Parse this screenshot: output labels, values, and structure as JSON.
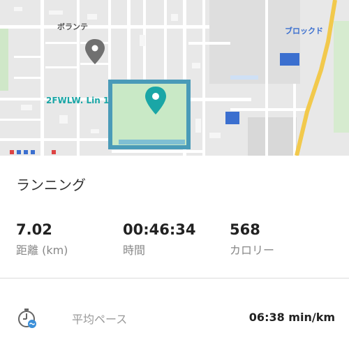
{
  "map": {
    "place_label_top": "ボランテ",
    "park_label": "2FWLW. Lin 1",
    "top_right_label": "ブロックド",
    "colors": {
      "background": "#e6e6e6",
      "road": "#ffffff",
      "park_fill": "#c9e9c6",
      "park_border": "#4a9bb8",
      "pin_teal": "#1aa6a6",
      "pin_gray": "#707070",
      "highway": "#f2c94c",
      "blue_marker": "#3b6fcf"
    }
  },
  "activity": {
    "title": "ランニング"
  },
  "stats": [
    {
      "value": "7.02",
      "label": "距離 (km)"
    },
    {
      "value": "00:46:34",
      "label": "時間"
    },
    {
      "value": "568",
      "label": "カロリー"
    }
  ],
  "pace": {
    "icon": "stopwatch-icon",
    "label": "平均ペース",
    "value": "06:38 min/km"
  }
}
